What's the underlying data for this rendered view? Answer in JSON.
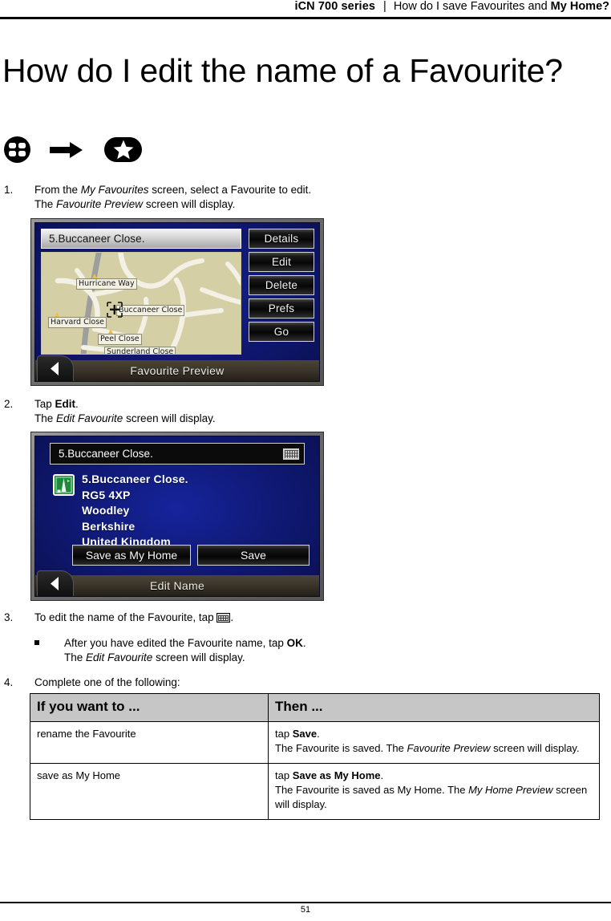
{
  "header": {
    "series": "iCN 700 series",
    "separator": "|",
    "topic_prefix": "How do I save Favourites and ",
    "topic_bold": "My Home?"
  },
  "title": "How do I edit the name of a Favourite?",
  "icon_row": {
    "menu_icon": "menu-grid-icon",
    "arrow_icon": "arrow-right-icon",
    "star_icon": "star-icon"
  },
  "steps": [
    {
      "number": "1.",
      "line1_a": "From the ",
      "line1_em": "My Favourites",
      "line1_b": " screen, select a Favourite to edit.",
      "line2_a": "The ",
      "line2_em": "Favourite Preview",
      "line2_b": " screen will display."
    },
    {
      "number": "2.",
      "line1_a": "Tap ",
      "line1_bold": "Edit",
      "line1_b": ".",
      "line2_a": "The ",
      "line2_em": "Edit Favourite",
      "line2_b": " screen will display."
    },
    {
      "number": "3.",
      "line1_a": "To edit the name of the Favourite, tap ",
      "line1_b": "."
    },
    {
      "number": "4.",
      "line1_a": "Complete one of the following:"
    }
  ],
  "bullet": {
    "line1_a": "After you have edited the Favourite name, tap ",
    "line1_bold": "OK",
    "line1_b": ".",
    "line2_a": "The ",
    "line2_em": "Edit Favourite",
    "line2_b": " screen will display."
  },
  "screenshot1": {
    "name": "favourite-preview-screen",
    "titlebar_text": "5.Buccaneer Close.",
    "status_text": "Favourite Preview",
    "back_icon": "back-chevron-icon",
    "buttons": [
      "Details",
      "Edit",
      "Delete",
      "Prefs",
      "Go"
    ],
    "map": {
      "background_color": "#d5cfa6",
      "road_color": "#f1efe4",
      "major_road_color": "#9a9a9a",
      "labels": [
        "Hurricane Way",
        "Buccaneer Close",
        "Harvard Close",
        "Peel Close",
        "Sunderland Close"
      ],
      "cursor_icon": "map-crosshair-icon"
    }
  },
  "screenshot2": {
    "name": "edit-favourite-screen",
    "titlebar_text": "5.Buccaneer Close.",
    "keyboard_icon": "keyboard-icon",
    "address_icon": "road-sign-icon",
    "address_lines": [
      "5.Buccaneer Close.",
      "RG5 4XP",
      "Woodley",
      "Berkshire",
      "United Kingdom"
    ],
    "buttons": [
      "Save as My Home",
      "Save"
    ],
    "status_text": "Edit Name",
    "back_icon": "back-chevron-icon"
  },
  "table": {
    "headers": [
      "If you want to ...",
      "Then ..."
    ],
    "rows": [
      {
        "want": "rename the Favourite",
        "then_line1_a": "tap ",
        "then_line1_bold": "Save",
        "then_line1_b": ".",
        "then_line2_a": "The Favourite is saved. The ",
        "then_line2_em": "Favourite Preview",
        "then_line2_b": " screen will display."
      },
      {
        "want": "save as My Home",
        "then_line1_a": "tap ",
        "then_line1_bold": "Save as My Home",
        "then_line1_b": ".",
        "then_line2_a": "The Favourite is saved as My Home. The ",
        "then_line2_em": "My Home Preview",
        "then_line2_b": " screen will display."
      }
    ]
  },
  "footer": {
    "page_number": "51"
  }
}
